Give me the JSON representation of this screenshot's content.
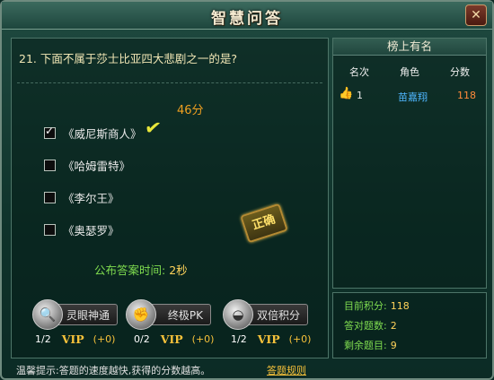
{
  "window": {
    "title": "智慧问答",
    "close_glyph": "✕"
  },
  "question": {
    "text": "21. 下面不属于莎士比亚四大悲剧之一的是?",
    "score": "46分",
    "options": [
      "《威尼斯商人》",
      "《哈姆雷特》",
      "《李尔王》",
      "《奥瑟罗》"
    ],
    "checked_option": 0,
    "correct_stamp": "正确",
    "reveal_label": "公布答案时间:",
    "reveal_value": "2秒"
  },
  "skills": [
    {
      "label": "灵眼神通",
      "icon": "magnifier-icon",
      "count": "1/2",
      "vip": "VIP",
      "bonus": "(+0)"
    },
    {
      "label": "终极PK",
      "icon": "fist-icon",
      "count": "0/2",
      "vip": "VIP",
      "bonus": "(+0)"
    },
    {
      "label": "双倍积分",
      "icon": "ingot-icon",
      "count": "1/2",
      "vip": "VIP",
      "bonus": "(+0)"
    }
  ],
  "leaderboard": {
    "title": "榜上有名",
    "headers": [
      "名次",
      "角色",
      "分数"
    ],
    "rows": [
      {
        "rank": "1",
        "name": "苗嘉翔",
        "score": "118"
      }
    ]
  },
  "stats": {
    "total_label": "目前积分:",
    "total_value": "118",
    "correct_label": "答对题数:",
    "correct_value": "2",
    "remaining_label": "剩余题目:",
    "remaining_value": "9"
  },
  "footer": {
    "tip_label": "温馨提示:",
    "tip_text": "答题的速度越快,获得的分数越高。",
    "rules_link": "答题规则"
  },
  "colors": {
    "score": "#f0a020",
    "green_text": "#7fdc4f",
    "gold": "#f6c13a",
    "name_blue": "#4fb6ff",
    "rank_score": "#ff8a3a"
  }
}
